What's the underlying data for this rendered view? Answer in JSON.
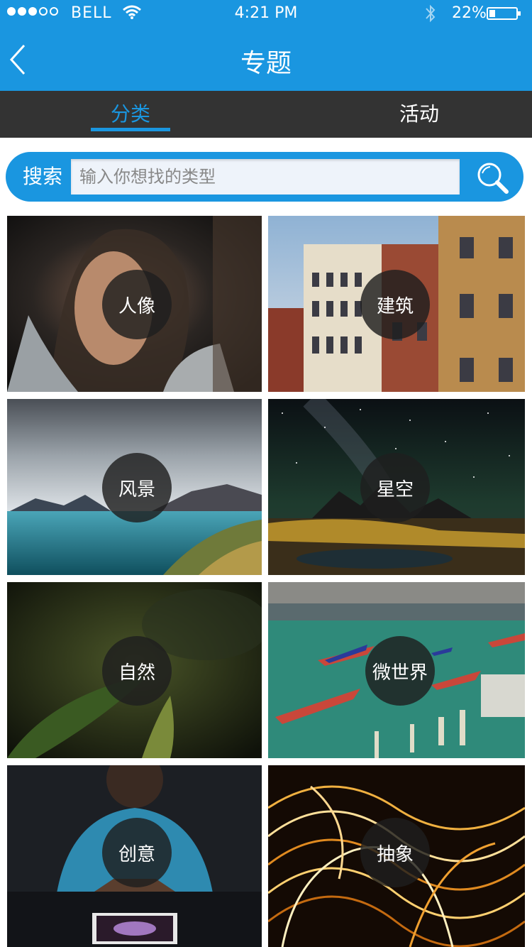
{
  "status_bar": {
    "carrier": "BELL",
    "time": "4:21 PM",
    "battery_text": "22%",
    "battery_level": 0.22
  },
  "header": {
    "title": "专题"
  },
  "tabs": [
    {
      "label": "分类",
      "active": true
    },
    {
      "label": "活动",
      "active": false
    }
  ],
  "search": {
    "label": "搜索",
    "placeholder": "输入你想找的类型"
  },
  "categories": [
    {
      "label": "人像",
      "theme": "portrait"
    },
    {
      "label": "建筑",
      "theme": "architecture"
    },
    {
      "label": "风景",
      "theme": "landscape"
    },
    {
      "label": "星空",
      "theme": "starry-sky"
    },
    {
      "label": "自然",
      "theme": "nature"
    },
    {
      "label": "微世界",
      "theme": "micro-world"
    },
    {
      "label": "创意",
      "theme": "creative"
    },
    {
      "label": "抽象",
      "theme": "abstract"
    }
  ],
  "colors": {
    "accent": "#1a96e0",
    "tab_bar": "#333333"
  }
}
